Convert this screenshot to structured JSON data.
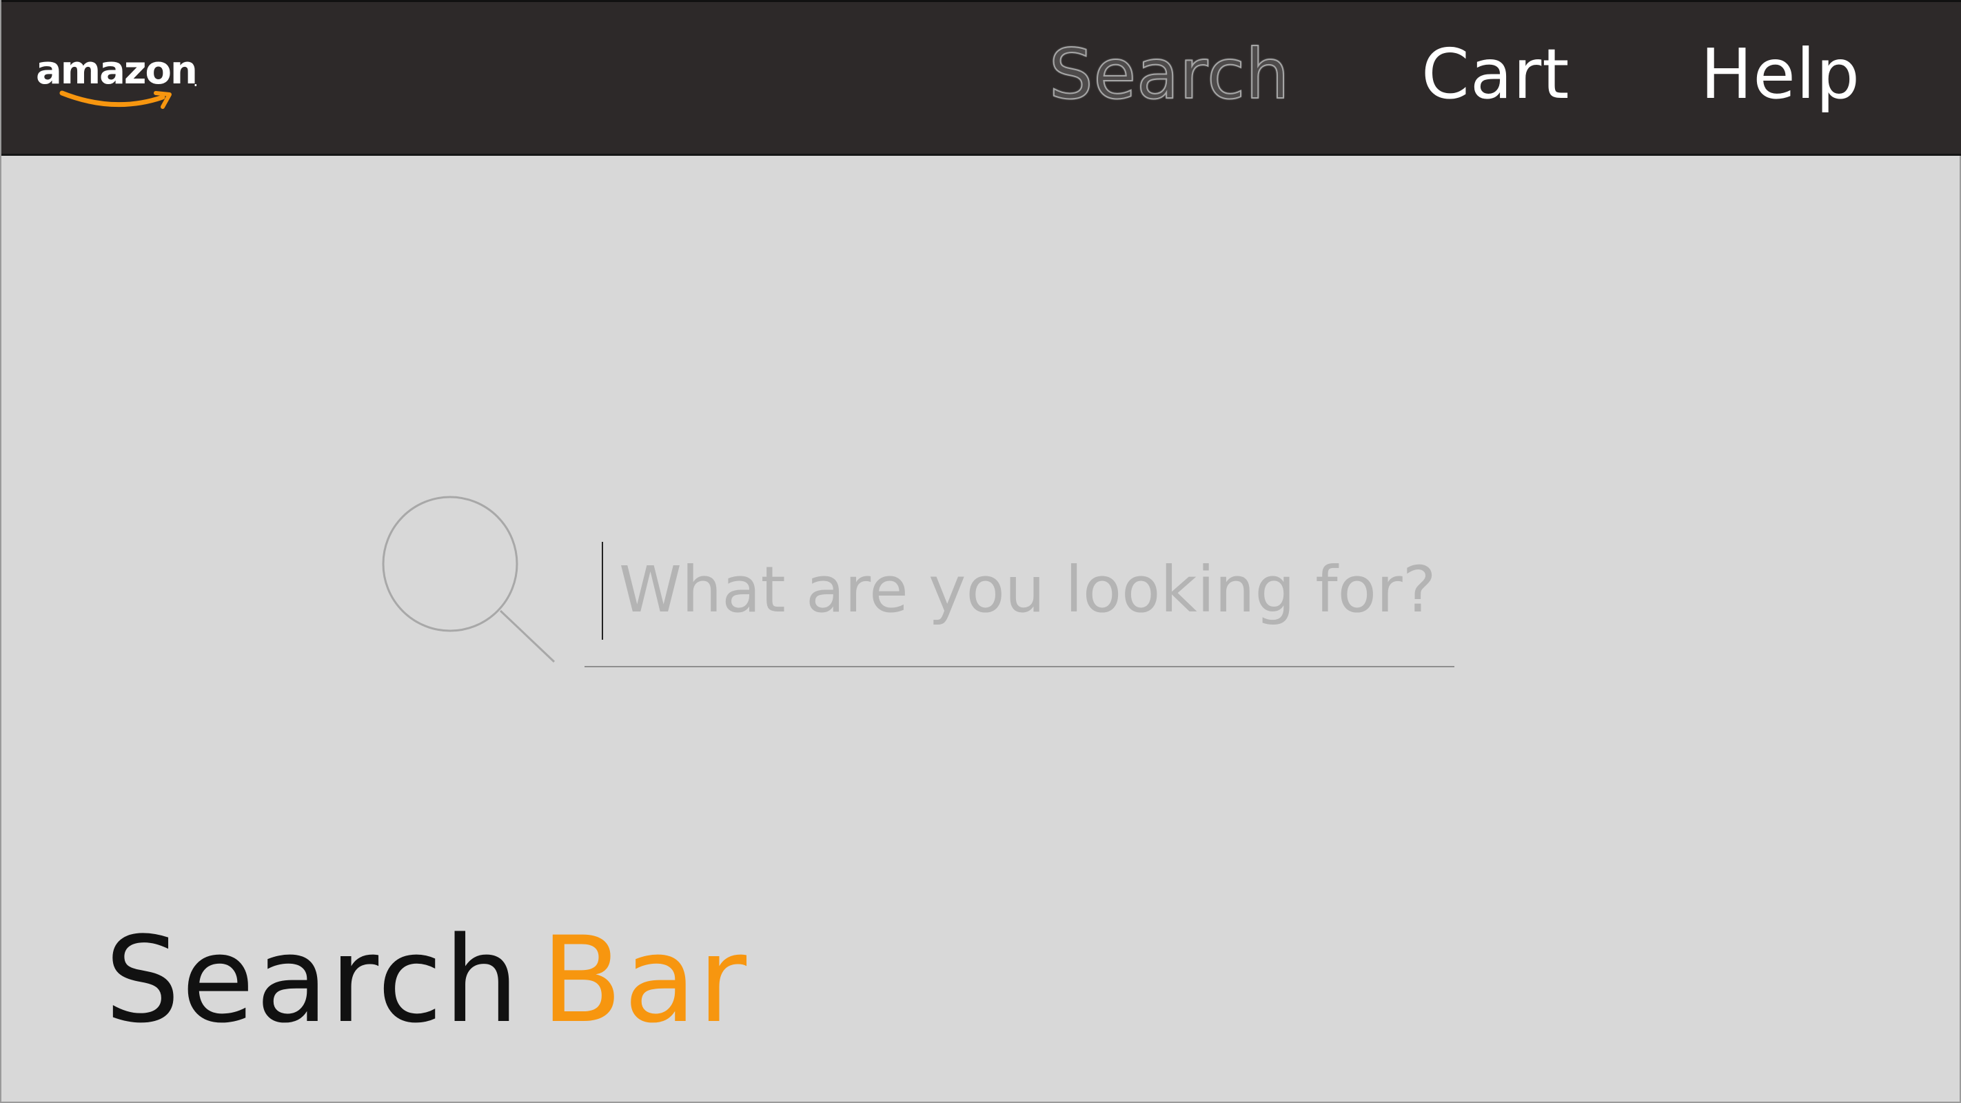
{
  "header": {
    "logo": {
      "text": "amazon",
      "dot": ".",
      "smile_color": "#f7960f"
    },
    "nav": [
      {
        "label": "Search",
        "state": "active",
        "color": "#4e4b4b"
      },
      {
        "label": "Cart",
        "state": "default",
        "color": "#ffffff"
      },
      {
        "label": "Help",
        "state": "default",
        "color": "#ffffff"
      }
    ],
    "background_color": "#2d2929"
  },
  "search": {
    "icon": "search-icon",
    "placeholder": "What are you looking for?",
    "value": ""
  },
  "title": {
    "part1": "Search",
    "part2": "Bar",
    "accent_color": "#f7960f"
  },
  "page": {
    "background_color": "#d8d8d8"
  }
}
